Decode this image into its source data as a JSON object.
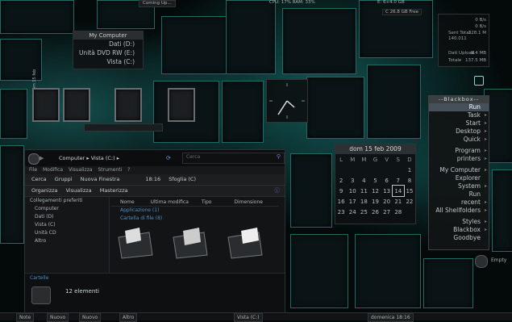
{
  "topbar": {
    "widget_a": "Coming Up...",
    "cpu": "CPU: 17% RAM: 33%",
    "disk_free": "C 26.8 GB Free",
    "disk_b": "E: 6+4.0 GB"
  },
  "my_computer": {
    "title": "My Computer",
    "drives": [
      "Dati (D:)",
      "Unità DVD RW (E:)",
      "Vista (C:)"
    ]
  },
  "digital_clock": {
    "digits": [
      "1",
      "3",
      "5",
      "6"
    ],
    "label": "Dom 15 feb"
  },
  "net_widget": {
    "rows": [
      "0 B/s",
      "0 B/s",
      "328.1 M",
      "140.011"
    ],
    "sent_label": "Sent Total",
    "upload_label": "Dati Upload",
    "upload_value": "9.4 MB",
    "total_label": "Totale",
    "total_value": "137.5 MB"
  },
  "calendar": {
    "header": "dom 15 feb 2009",
    "days": [
      "L",
      "M",
      "M",
      "G",
      "V",
      "S",
      "D"
    ],
    "weeks": [
      [
        "",
        "",
        "",
        "",
        "",
        "",
        "1"
      ],
      [
        "2",
        "3",
        "4",
        "5",
        "6",
        "7",
        "8"
      ],
      [
        "9",
        "10",
        "11",
        "12",
        "13",
        "14",
        "15"
      ],
      [
        "16",
        "17",
        "18",
        "19",
        "20",
        "21",
        "22"
      ],
      [
        "23",
        "24",
        "25",
        "26",
        "27",
        "28",
        ""
      ]
    ],
    "today": "14"
  },
  "blackbox": {
    "title": "--Blackbox--",
    "items": [
      "Run",
      "Task",
      "Start",
      "Desktop",
      "Quick",
      "Program",
      "printers",
      "My Computer",
      "Explorer",
      "System",
      "Run",
      "recent",
      "All Shellfolders",
      "Styles",
      "Blackbox",
      "Goodbye"
    ]
  },
  "empty_button": "Empty",
  "explorer": {
    "breadcrumb": [
      "Computer",
      "Vista (C:)"
    ],
    "search_placeholder": "Cerca",
    "menu": [
      "File",
      "Modifica",
      "Visualizza",
      "Strumenti",
      "?"
    ],
    "secondary_toolbar": [
      "Cerca",
      "Gruppi",
      "Nuova Finestra",
      "18:16",
      "Sfoglia (C)"
    ],
    "toolbar": [
      "Organizza",
      "Visualizza",
      "Masterizza"
    ],
    "nav_title": "Collegamenti preferiti",
    "nav": [
      "Computer",
      "Dati (D)",
      "Vista (C)",
      "Unità CD",
      "Altro"
    ],
    "columns": [
      "Nome",
      "Ultima modifica",
      "Tipo",
      "Dimensione"
    ],
    "groups": [
      "Applicazione (1)",
      "Cartella di file (8)"
    ],
    "status_label": "Cartelle",
    "status_count": "12 elementi"
  },
  "taskbar": {
    "items": [
      "Note",
      "Nuovo",
      "Nuovo",
      "Altro",
      "Vista (C:)",
      "domenica 18:16"
    ]
  }
}
